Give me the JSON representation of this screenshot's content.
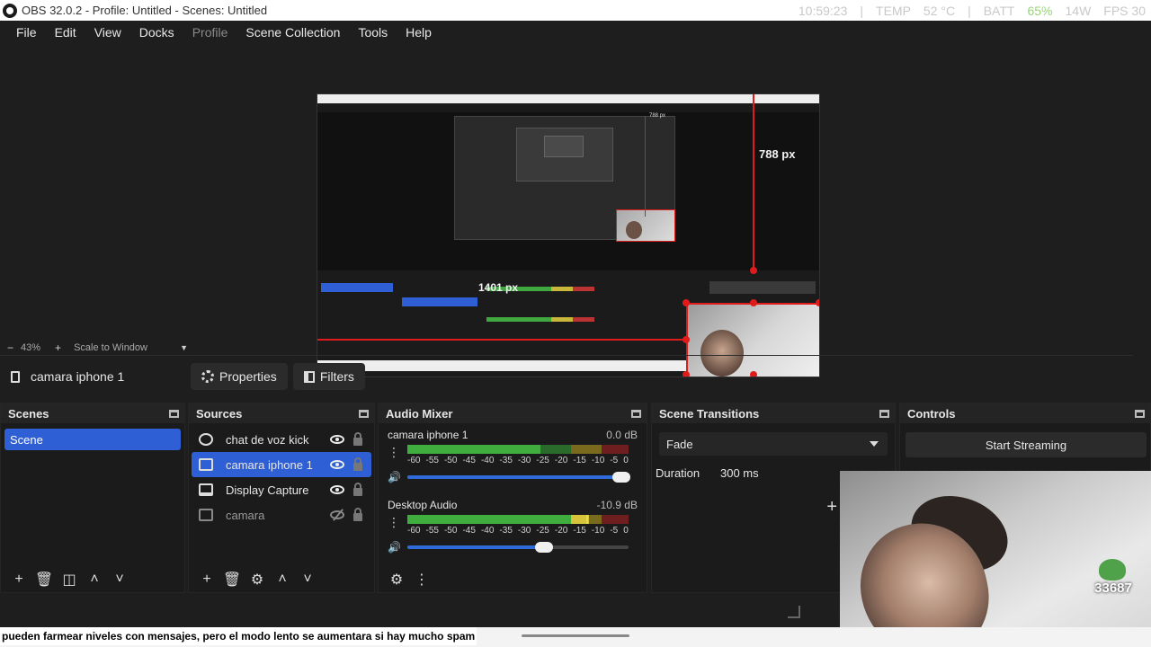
{
  "window": {
    "title": "OBS 32.0.2 - Profile: Untitled - Scenes: Untitled"
  },
  "stats": {
    "time": "10:59:23",
    "temp_label": "TEMP",
    "temp_value": "52 °C",
    "batt_label": "BATT",
    "batt_value": "65%",
    "watts": "14W",
    "fps": "FPS 30"
  },
  "menu": {
    "items": [
      "File",
      "Edit",
      "View",
      "Docks",
      "Profile",
      "Scene Collection",
      "Tools",
      "Help"
    ]
  },
  "preview": {
    "measure_vertical": "788 px",
    "measure_horizontal": "1401 px",
    "measure_mini": "788 px"
  },
  "zoom": {
    "minus": "−",
    "value": "43%",
    "plus": "+",
    "mode": "Scale to Window"
  },
  "source_toolbar": {
    "selected_source": "camara iphone 1",
    "properties_label": "Properties",
    "filters_label": "Filters"
  },
  "scenes": {
    "title": "Scenes",
    "items": [
      "Scene"
    ]
  },
  "sources": {
    "title": "Sources",
    "items": [
      {
        "label": "chat de voz kick",
        "type": "browser-source-icon",
        "visible": true
      },
      {
        "label": "camara iphone 1",
        "type": "media-source-icon",
        "visible": true,
        "selected": true
      },
      {
        "label": "Display Capture",
        "type": "display-capture-icon",
        "visible": true
      },
      {
        "label": "camara",
        "type": "video-capture-icon",
        "visible": false
      }
    ]
  },
  "mixer": {
    "title": "Audio Mixer",
    "channels": [
      {
        "name": "camara iphone 1",
        "db": "0.0 dB",
        "volume": 1.0
      },
      {
        "name": "Desktop Audio",
        "db": "-10.9 dB",
        "volume": 0.62
      }
    ],
    "ticks": [
      "-60",
      "-55",
      "-50",
      "-45",
      "-40",
      "-35",
      "-30",
      "-25",
      "-20",
      "-15",
      "-10",
      "-5",
      "0"
    ]
  },
  "transitions": {
    "title": "Scene Transitions",
    "selected": "Fade",
    "duration_label": "Duration",
    "duration_value": "300 ms"
  },
  "controls": {
    "title": "Controls",
    "start_streaming": "Start Streaming"
  },
  "overlay": {
    "points": "33687",
    "subtitle": "pueden farmear niveles con mensajes, pero el modo lento se aumentara si hay mucho spam"
  },
  "colors": {
    "selection": "#2f5fd4",
    "bounding_box": "#e01b1b",
    "meter_green": "#3fae3f"
  }
}
